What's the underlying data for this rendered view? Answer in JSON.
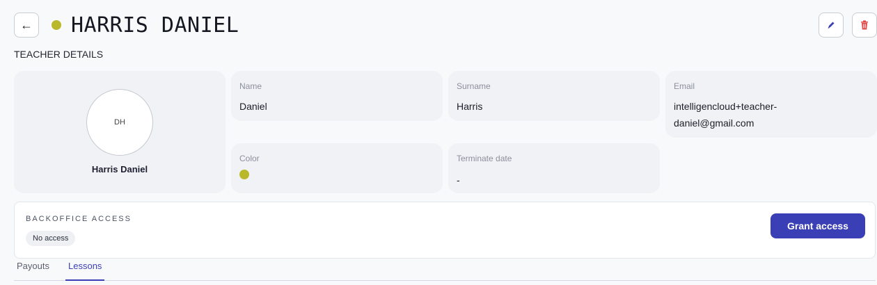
{
  "header": {
    "back_label": "←",
    "title": "HARRIS DANIEL",
    "status_color": "#b9b82a",
    "edit_icon": "pencil-icon",
    "delete_icon": "trash-icon"
  },
  "section": {
    "label": "TEACHER DETAILS"
  },
  "profile": {
    "initials": "DH",
    "name": "Harris Daniel"
  },
  "fields": {
    "name": {
      "label": "Name",
      "value": "Daniel"
    },
    "surname": {
      "label": "Surname",
      "value": "Harris"
    },
    "email": {
      "label": "Email",
      "value": "intelligencloud+teacher-daniel@gmail.com"
    },
    "color": {
      "label": "Color",
      "value": "#b9b82a"
    },
    "terminate": {
      "label": "Terminate date",
      "value": "-"
    }
  },
  "access": {
    "title": "BACKOFFICE ACCESS",
    "status": "No access",
    "grant_label": "Grant access"
  },
  "tabs": [
    {
      "label": "Payouts",
      "active": false
    },
    {
      "label": "Lessons",
      "active": true
    }
  ],
  "colors": {
    "accent": "#3a3fb6",
    "danger": "#e04a4a",
    "status": "#b9b82a"
  }
}
